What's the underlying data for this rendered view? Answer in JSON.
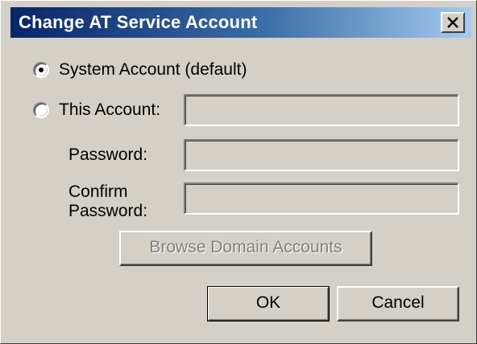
{
  "window": {
    "title": "Change AT Service Account",
    "close_glyph": "✕"
  },
  "account_options": {
    "system_account_label": "System Account (default)",
    "system_account_selected": true,
    "this_account_label": "This Account:",
    "this_account_selected": false,
    "this_account_value": ""
  },
  "fields": {
    "password_label": "Password:",
    "password_value": "",
    "confirm_label_line1": "Confirm",
    "confirm_label_line2": "Password:",
    "confirm_value": ""
  },
  "buttons": {
    "browse_label": "Browse Domain Accounts",
    "ok_label": "OK",
    "cancel_label": "Cancel"
  },
  "icons": {
    "close": "close-icon"
  },
  "colors": {
    "dialog_bg": "#d4d0c8",
    "title_gradient_start": "#0a246a",
    "title_gradient_end": "#a6caf0",
    "title_text": "#ffffff",
    "disabled_text": "#808080"
  }
}
